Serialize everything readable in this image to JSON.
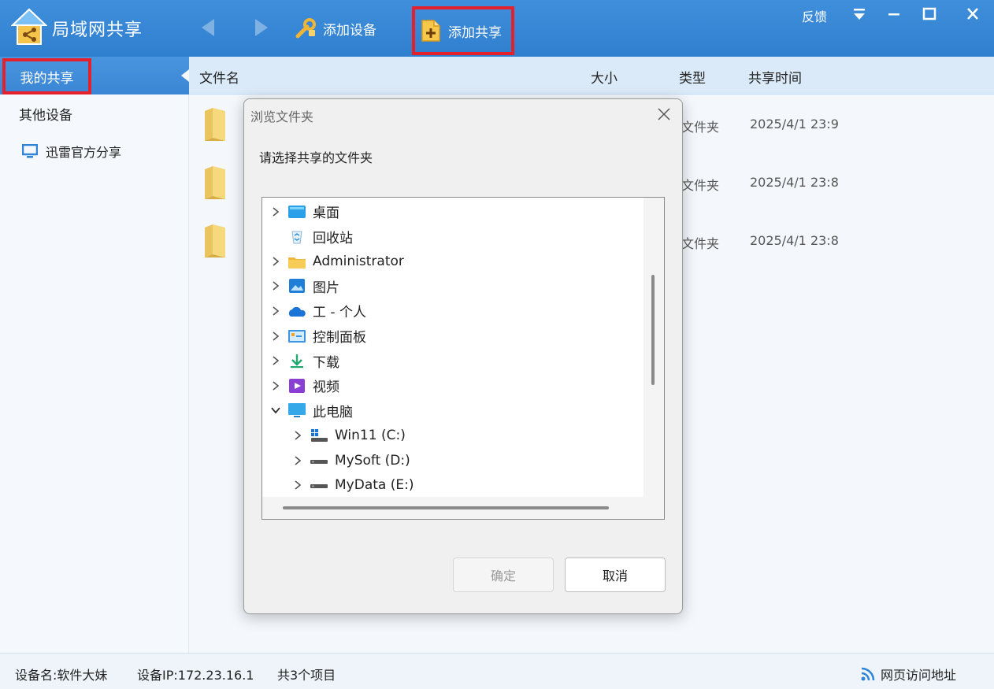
{
  "app": {
    "title": "局域网共享",
    "add_device_label": "添加设备",
    "add_share_label": "添加共享",
    "feedback_label": "反馈"
  },
  "sidebar": {
    "items": [
      {
        "label": "我的共享"
      },
      {
        "label": "其他设备"
      },
      {
        "label": "迅雷官方分享"
      }
    ]
  },
  "file_list": {
    "columns": [
      "文件名",
      "大小",
      "类型",
      "共享时间"
    ],
    "rows": [
      {
        "type": "文件夹",
        "time": "2025/4/1 23:9"
      },
      {
        "type": "文件夹",
        "time": "2025/4/1 23:8"
      },
      {
        "type": "文件夹",
        "time": "2025/4/1 23:8"
      }
    ]
  },
  "status": {
    "device_name": "设备名:软件大妹",
    "device_ip": "设备IP:172.23.16.1",
    "item_count": "共3个项目",
    "web_address": "网页访问地址"
  },
  "dialog": {
    "title": "浏览文件夹",
    "prompt": "请选择共享的文件夹",
    "ok_label": "确定",
    "cancel_label": "取消",
    "tree": [
      {
        "label": "桌面",
        "icon": "desktop-icon",
        "expander": "collapsed",
        "level": 0
      },
      {
        "label": "回收站",
        "icon": "recycle-bin-icon",
        "expander": "none",
        "level": 0
      },
      {
        "label": "Administrator",
        "icon": "user-folder-icon",
        "expander": "collapsed",
        "level": 0
      },
      {
        "label": "图片",
        "icon": "pictures-icon",
        "expander": "collapsed",
        "level": 0
      },
      {
        "label": "工 - 个人",
        "icon": "onedrive-icon",
        "expander": "collapsed",
        "level": 0
      },
      {
        "label": "控制面板",
        "icon": "control-panel-icon",
        "expander": "collapsed",
        "level": 0
      },
      {
        "label": "下载",
        "icon": "download-icon",
        "expander": "collapsed",
        "level": 0
      },
      {
        "label": "视频",
        "icon": "videos-icon",
        "expander": "collapsed",
        "level": 0
      },
      {
        "label": "此电脑",
        "icon": "this-pc-icon",
        "expander": "expanded",
        "level": 0
      },
      {
        "label": "Win11 (C:)",
        "icon": "windows-drive-icon",
        "expander": "collapsed",
        "level": 1
      },
      {
        "label": "MySoft (D:)",
        "icon": "drive-icon",
        "expander": "collapsed",
        "level": 1
      },
      {
        "label": "MyData (E:)",
        "icon": "drive-icon",
        "expander": "collapsed",
        "level": 1
      }
    ]
  },
  "colors": {
    "titlebar": "#3a8ad8",
    "highlight_border": "#e5202a"
  }
}
